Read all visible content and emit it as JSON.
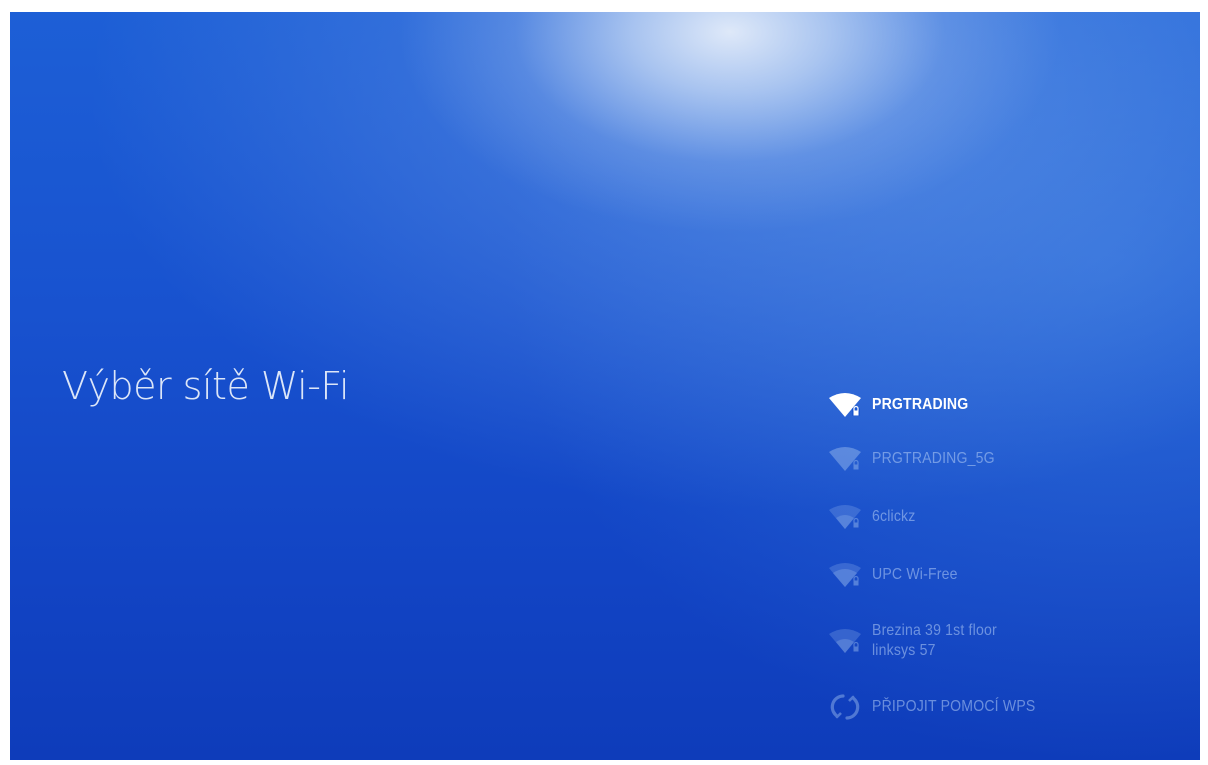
{
  "page": {
    "title": "Výběr sítě Wi-Fi"
  },
  "networks": [
    {
      "name": "PRGTRADING",
      "selected": true,
      "secured": true,
      "icon": "wifi-lock-icon"
    },
    {
      "name": "PRGTRADING_5G",
      "selected": false,
      "secured": true,
      "icon": "wifi-lock-icon"
    },
    {
      "name": "6clickz",
      "selected": false,
      "secured": true,
      "icon": "wifi-lock-icon"
    },
    {
      "name": "UPC Wi-Free",
      "selected": false,
      "secured": true,
      "icon": "wifi-lock-icon"
    },
    {
      "name_line1": "Brezina 39 1st floor",
      "name_line2": "linksys 57",
      "selected": false,
      "secured": true,
      "icon": "wifi-lock-icon"
    }
  ],
  "wps": {
    "label": "PŘIPOJIT POMOCÍ WPS",
    "icon": "wps-icon"
  },
  "colors": {
    "background_top": "#1d5fd6",
    "background_bottom": "#0e3cba",
    "selected_text": "#ffffff",
    "dim_text": "#b4cdf5"
  }
}
